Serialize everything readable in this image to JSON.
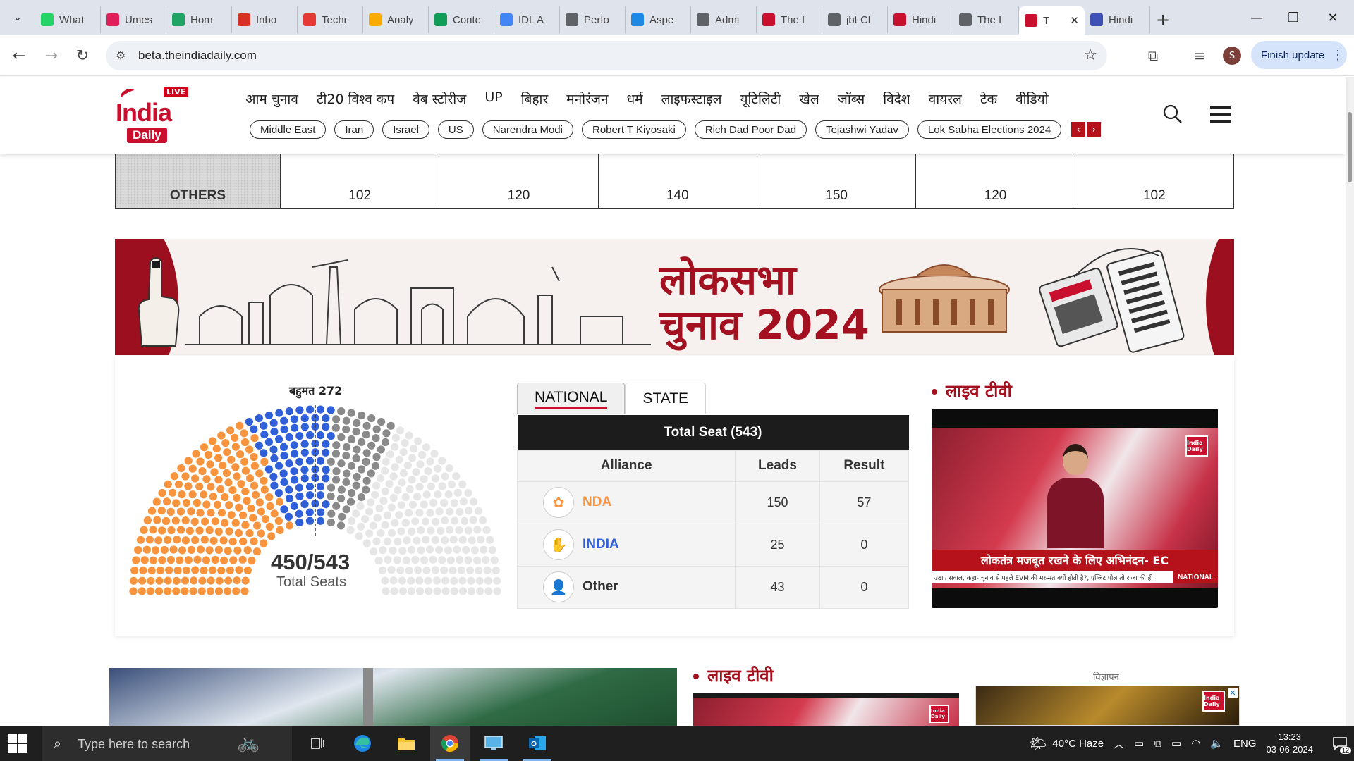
{
  "browser": {
    "tabs": [
      {
        "title": "What",
        "icon": "whatsapp-icon",
        "color": "#25d366"
      },
      {
        "title": "Umes",
        "icon": "slack-icon",
        "color": "#e01e5a"
      },
      {
        "title": "Hom",
        "icon": "google-drive-icon",
        "color": "#1fa463"
      },
      {
        "title": "Inbo",
        "icon": "gmail-icon",
        "color": "#d93025"
      },
      {
        "title": "Techr",
        "icon": "app-icon",
        "color": "#e53935"
      },
      {
        "title": "Analy",
        "icon": "analytics-icon",
        "color": "#f9ab00"
      },
      {
        "title": "Conte",
        "icon": "sheets-icon",
        "color": "#0f9d58"
      },
      {
        "title": "IDL A",
        "icon": "docs-icon",
        "color": "#4285f4"
      },
      {
        "title": "Perfo",
        "icon": "performance-icon",
        "color": "#5f6368"
      },
      {
        "title": "Aspe",
        "icon": "chart-icon",
        "color": "#1e88e5"
      },
      {
        "title": "Admi",
        "icon": "globe-icon",
        "color": "#5f6368"
      },
      {
        "title": "The I",
        "icon": "india-daily-icon",
        "color": "#c8102e"
      },
      {
        "title": "jbt Cl",
        "icon": "globe-icon",
        "color": "#5f6368"
      },
      {
        "title": "Hindi",
        "icon": "news-icon",
        "color": "#c8102e"
      },
      {
        "title": "The I",
        "icon": "globe-icon",
        "color": "#5f6368"
      },
      {
        "title": "T",
        "icon": "india-daily-icon",
        "color": "#c8102e",
        "active": true
      },
      {
        "title": "Hindi",
        "icon": "news-icon",
        "color": "#3f51b5"
      }
    ],
    "url": "beta.theindiadaily.com",
    "profile_initial": "S",
    "finish_update_label": "Finish update"
  },
  "site": {
    "logo": {
      "live": "LIVE",
      "india": "India",
      "daily": "Daily"
    },
    "nav": [
      "आम चुनाव",
      "टी20 विश्व कप",
      "वेब स्टोरीज",
      "UP",
      "बिहार",
      "मनोरंजन",
      "धर्म",
      "लाइफस्टाइल",
      "यूटिलिटी",
      "खेल",
      "जॉब्स",
      "विदेश",
      "वायरल",
      "टेक",
      "वीडियो"
    ],
    "tags": [
      "Middle East",
      "Iran",
      "Israel",
      "US",
      "Narendra Modi",
      "Robert T Kiyosaki",
      "Rich Dad Poor Dad",
      "Tejashwi Yadav",
      "Lok Sabha Elections 2024"
    ]
  },
  "seat_table": {
    "row_label": "OTHERS",
    "values": [
      "102",
      "120",
      "140",
      "150",
      "120",
      "102"
    ]
  },
  "banner": {
    "line1": "लोकसभा",
    "line2": "चुनाव 2024"
  },
  "results": {
    "majority_label": "बहुमत 272",
    "seat_count": "450/543",
    "seat_label": "Total Seats",
    "seat_distribution": {
      "total": 543,
      "nda": 207,
      "india": 84,
      "other": 59,
      "undeclared": 193
    },
    "colors": {
      "nda": "#f7943d",
      "india": "#2f5fd9",
      "other": "#8a8a8a",
      "undeclared": "#e6e6e6"
    },
    "tabs": [
      "NATIONAL",
      "STATE"
    ],
    "table_caption": "Total Seat (543)",
    "columns": [
      "Alliance",
      "Leads",
      "Result"
    ],
    "rows": [
      {
        "name": "NDA",
        "icon": "lotus-icon",
        "leads": "150",
        "result": "57",
        "color": "#f7943d"
      },
      {
        "name": "INDIA",
        "icon": "hand-icon",
        "leads": "25",
        "result": "0",
        "color": "#2f5fd9"
      },
      {
        "name": "Other",
        "icon": "person-icon",
        "leads": "43",
        "result": "0",
        "color": "#333333"
      }
    ]
  },
  "live_tv": {
    "heading": "लाइव टीवी",
    "chyron": "लोकतंत्र मजबूत रखने के लिए अभिनंदन- EC",
    "ticker": "उठाए सवाल, कहा- चुनाव से पहले EVM की मरम्मत क्यों होती है?, एग्जिट पोल तो राजा की ही",
    "ticker_tag": "NATIONAL",
    "channel_logo": "India Daily"
  },
  "lower": {
    "live_heading": "लाइव टीवी",
    "ad_label": "विज्ञापन"
  },
  "taskbar": {
    "search_placeholder": "Type here to search",
    "weather": "40°C  Haze",
    "language": "ENG",
    "time": "13:23",
    "date": "03-06-2024",
    "notifications": "12"
  }
}
